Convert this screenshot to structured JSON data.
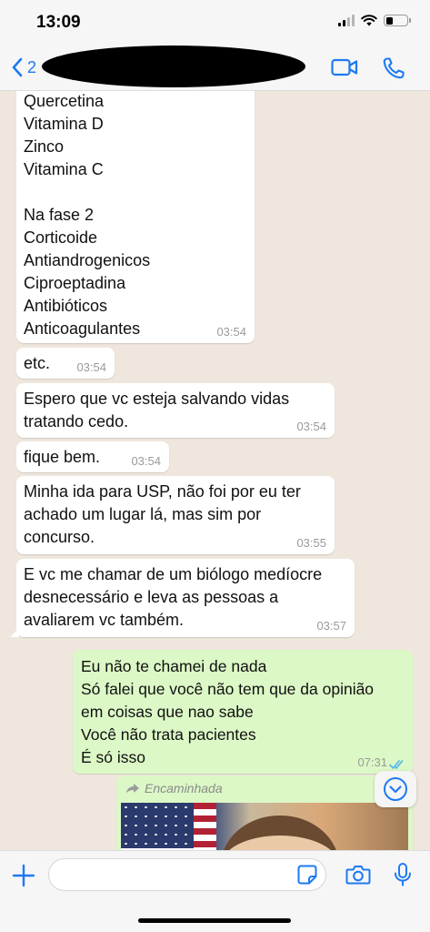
{
  "status_bar": {
    "time": "13:09"
  },
  "header": {
    "back_count": "2",
    "contact_name": "",
    "icons": {
      "back": "chevron-left-icon",
      "video": "video-camera-icon",
      "call": "phone-icon"
    }
  },
  "colors": {
    "accent": "#1d7af2",
    "incoming_bubble": "#ffffff",
    "outgoing_bubble": "#dcf8c6",
    "chat_background": "#efe7dd",
    "read_ticks": "#4fb6ec"
  },
  "messages": [
    {
      "direction": "in",
      "text": "Quercetina\nVitamina D\nZinco\nVitamina C\n\nNa fase 2\nCorticoide\nAntiandrogenicos\nCiproeptadina\nAntibióticos\nAnticoagulantes",
      "time": "03:54"
    },
    {
      "direction": "in",
      "text": "etc.",
      "time": "03:54"
    },
    {
      "direction": "in",
      "text": "Espero que vc esteja salvando vidas\ntratando cedo.",
      "time": "03:54"
    },
    {
      "direction": "in",
      "text": "fique bem.",
      "time": "03:54"
    },
    {
      "direction": "in",
      "text": "Minha ida para USP, não foi por eu ter\nachado um lugar lá, mas sim por\nconcurso.",
      "time": "03:55"
    },
    {
      "direction": "in",
      "text": "E vc me chamar de um biólogo medíocre\ndesnecessário e leva as pessoas a\navaliarem vc também.",
      "time": "03:57"
    },
    {
      "direction": "out",
      "text": "Eu não te chamei de nada\nSó falei que você não tem que da opinião\nem coisas que nao sabe\nVocê não trata pacientes\nÉ só isso",
      "time": "07:31",
      "status": "read"
    }
  ],
  "forwarded": {
    "label": "Encaminhada",
    "icon": "forward-arrow-icon"
  },
  "input_bar": {
    "placeholder": "",
    "icons": {
      "add": "plus-icon",
      "sticker": "sticker-icon",
      "camera": "camera-icon",
      "mic": "microphone-icon"
    }
  }
}
